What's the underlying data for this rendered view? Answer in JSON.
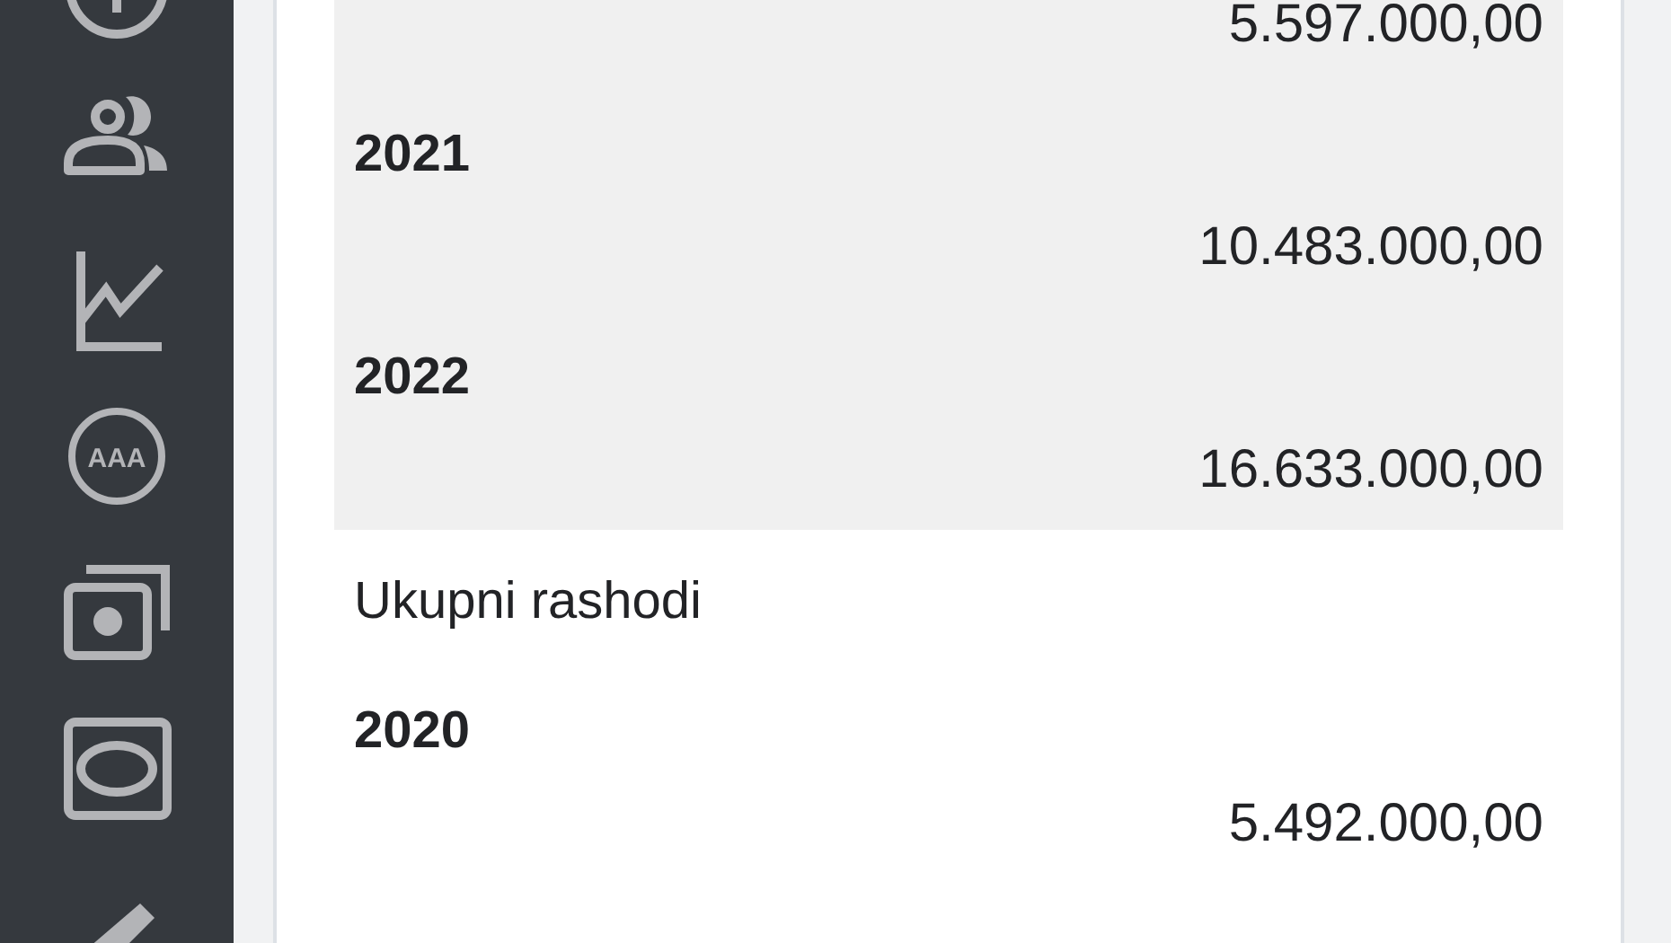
{
  "sidebar": {
    "items": [
      {
        "kind": "plus-circle"
      },
      {
        "kind": "people"
      },
      {
        "kind": "chart"
      },
      {
        "kind": "badge",
        "text": "AAA"
      },
      {
        "kind": "photos"
      },
      {
        "kind": "frame"
      },
      {
        "kind": "brush"
      }
    ]
  },
  "sections": [
    {
      "highlighted": true,
      "entries": [
        {
          "value": "5.597.000,00"
        },
        {
          "year": "2021",
          "value": "10.483.000,00"
        },
        {
          "year": "2022",
          "value": "16.633.000,00"
        }
      ]
    },
    {
      "highlighted": false,
      "title": "Ukupni rashodi",
      "entries": [
        {
          "year": "2020",
          "value": "5.492.000,00"
        }
      ]
    }
  ]
}
